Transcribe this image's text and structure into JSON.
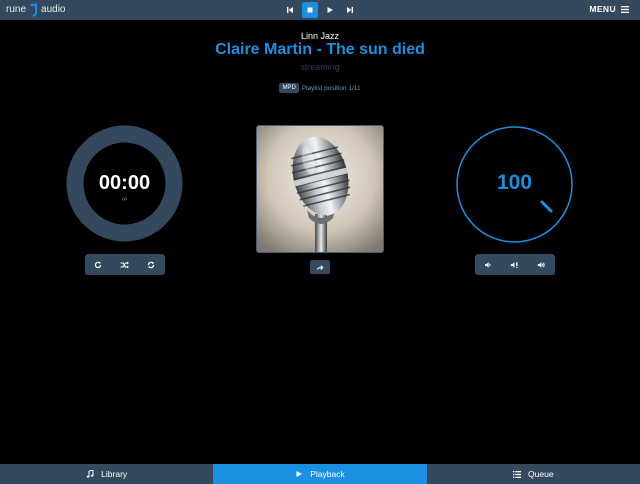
{
  "header": {
    "logo": {
      "left": "rune",
      "right": "audio"
    },
    "transport": [
      {
        "name": "previous-button",
        "icon": "skip-back-icon"
      },
      {
        "name": "stop-button",
        "icon": "stop-icon",
        "active": true
      },
      {
        "name": "play-button",
        "icon": "play-icon"
      },
      {
        "name": "next-button",
        "icon": "skip-forward-icon"
      }
    ],
    "menu_label": "MENU"
  },
  "now_playing": {
    "station": "Linn Jazz",
    "track": "Claire Martin - The sun died",
    "state": "streaming",
    "source_badge": "MPD",
    "playlist_position": "Playlist position 1/11"
  },
  "timer": {
    "elapsed": "00:00",
    "total": "∞"
  },
  "volume": {
    "level": "100"
  },
  "timer_controls": [
    "repeat-icon",
    "shuffle-icon",
    "single-repeat-icon"
  ],
  "volume_controls": [
    "volume-down-icon",
    "mute-icon",
    "volume-up-icon"
  ],
  "footer": {
    "tabs": [
      {
        "label": "Library",
        "icon": "music-note-icon"
      },
      {
        "label": "Playback",
        "icon": "play-icon",
        "active": true
      },
      {
        "label": "Queue",
        "icon": "list-icon"
      }
    ]
  },
  "colors": {
    "accent": "#1b8fe0",
    "bar": "#34495e",
    "background": "#000000",
    "muted_text": "#2c3e50",
    "secondary_text": "#7795b4"
  }
}
